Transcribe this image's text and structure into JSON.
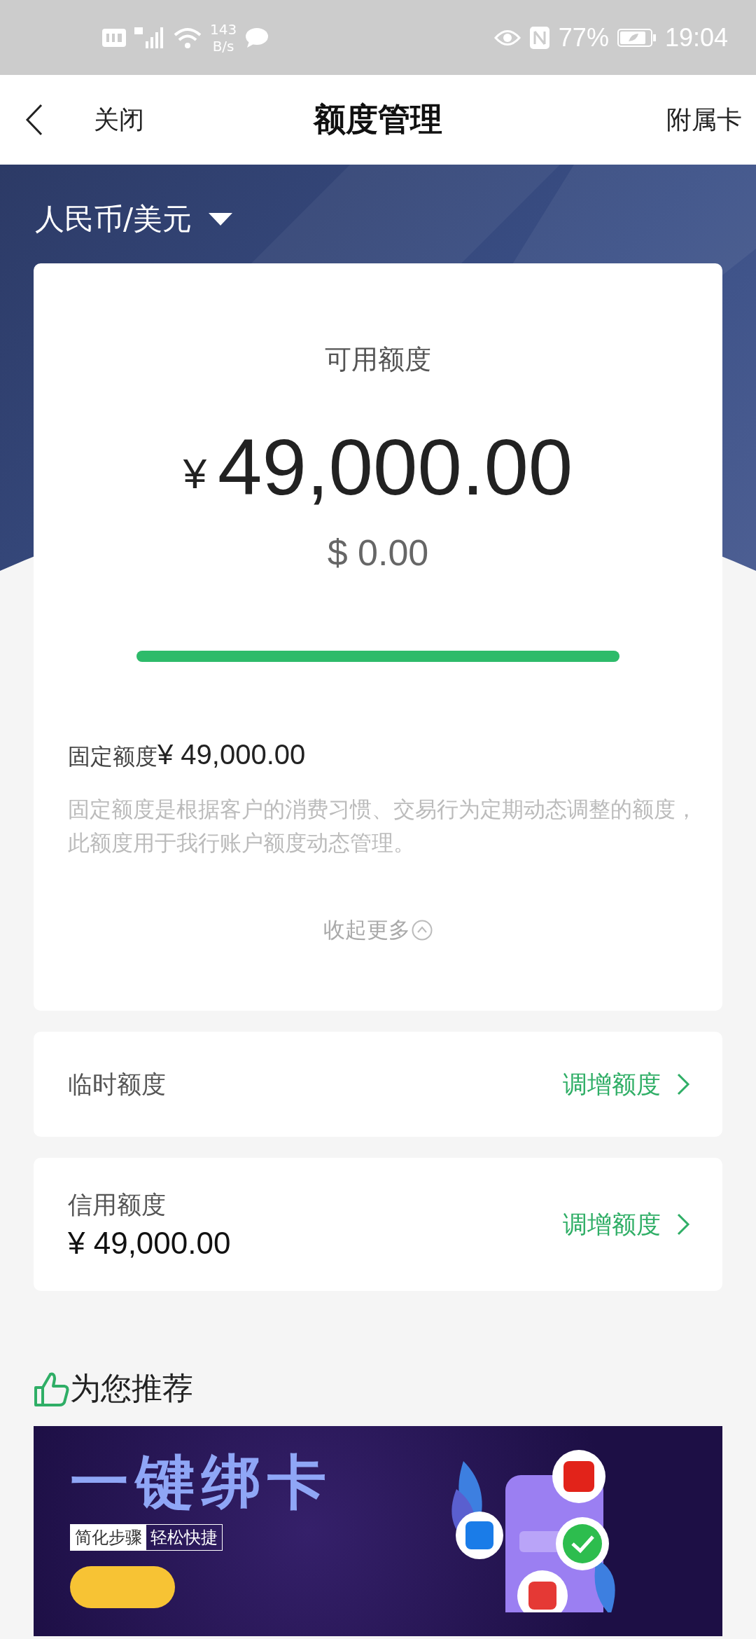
{
  "status_bar": {
    "speed": "143",
    "speed_unit": "B/s",
    "battery": "77%",
    "time": "19:04"
  },
  "nav": {
    "close": "关闭",
    "title": "额度管理",
    "action": "附属卡"
  },
  "currency": {
    "label": "人民币/美元"
  },
  "available": {
    "label": "可用额度",
    "cny_symbol": "¥",
    "cny": "49,000.00",
    "usd": "$ 0.00",
    "level": 1.0
  },
  "fixed": {
    "label": "固定额度",
    "amount": "¥ 49,000.00",
    "description": "固定额度是根据客户的消费习惯、交易行为定期动态调整的额度，此额度用于我行账户额度动态管理。",
    "toggle": "收起更多",
    "expanded": true
  },
  "limits": [
    {
      "label": "临时额度",
      "action": "调增额度"
    },
    {
      "label": "信用额度",
      "amount": "¥ 49,000.00",
      "action": "调增额度"
    }
  ],
  "recommend": {
    "title": "为您推荐",
    "banner": {
      "headline": "一键绑卡",
      "tags": [
        "简化步骤",
        "轻松快捷"
      ]
    }
  }
}
